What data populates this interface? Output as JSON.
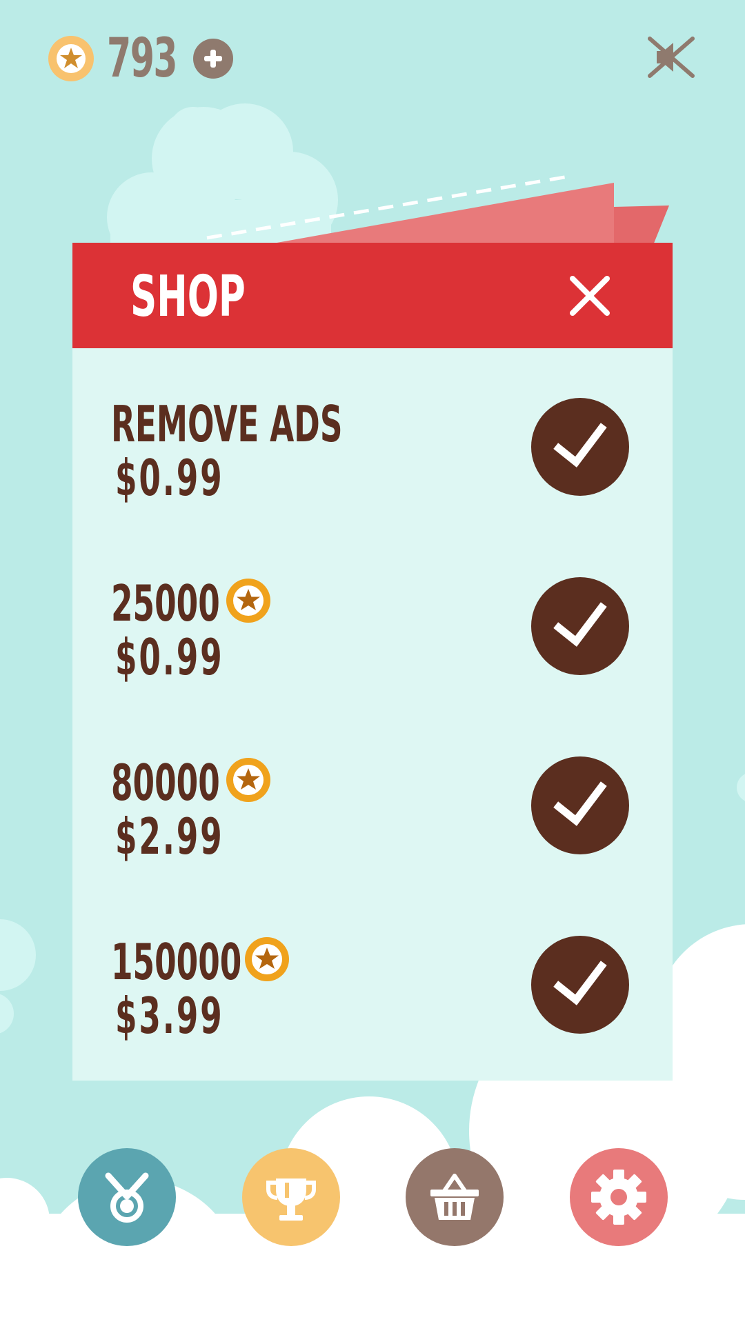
{
  "header": {
    "coin_count": "793",
    "coin_icon": "star-coin-icon",
    "add_coins_icon": "plus-icon",
    "sound_icon": "sound-muted-icon"
  },
  "shop": {
    "title": "SHOP",
    "close_icon": "close-icon",
    "items": [
      {
        "name": "REMOVE ADS",
        "price": "$0.99",
        "has_coin_icon": false,
        "buy_icon": "checkmark-icon"
      },
      {
        "name": "25000",
        "price": "$0.99",
        "has_coin_icon": true,
        "buy_icon": "checkmark-icon"
      },
      {
        "name": "80000",
        "price": "$2.99",
        "has_coin_icon": true,
        "buy_icon": "checkmark-icon"
      },
      {
        "name": "150000",
        "price": "$3.99",
        "has_coin_icon": true,
        "buy_icon": "checkmark-icon"
      }
    ]
  },
  "bottom_nav": [
    {
      "id": "achievements",
      "icon": "medal-icon",
      "color": "#5ba5b0"
    },
    {
      "id": "leaderboard",
      "icon": "trophy-icon",
      "color": "#f7c46e"
    },
    {
      "id": "shop",
      "icon": "basket-icon",
      "color": "#94776b"
    },
    {
      "id": "settings",
      "icon": "gear-icon",
      "color": "#e87a7b"
    }
  ],
  "colors": {
    "background": "#bbebe7",
    "panel": "#def7f3",
    "header_red": "#dc3236",
    "brown": "#5b2e1f",
    "coin_orange": "#f0a21c",
    "coin_star": "#b4660f",
    "top_coin_fill": "#f8c26e",
    "muted_gray": "#8f7a6e"
  }
}
